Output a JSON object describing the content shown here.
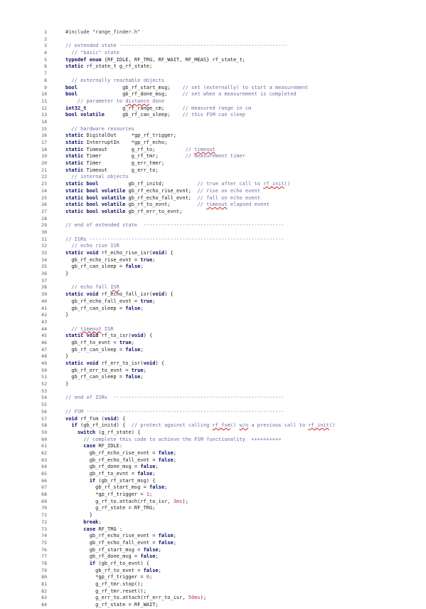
{
  "document": {
    "language": "c++",
    "lines": [
      [
        [
          "pp",
          "#include \"range_finder.h\""
        ]
      ],
      [],
      [
        [
          "cm",
          "// extended state --------------------------------------------------------"
        ]
      ],
      [
        [
          "cm",
          "  // \"basic\" state"
        ]
      ],
      [
        [
          "kw",
          "typedef enum"
        ],
        [
          "t",
          " {RF_IDLE, RF_TRG, RF_WAIT, RF_MEAS} rf_state_t;"
        ]
      ],
      [
        [
          "kw",
          "static"
        ],
        [
          "t",
          " rf_state_t g_rf_state;"
        ]
      ],
      [],
      [
        [
          "cm",
          "  // externally reachable objects"
        ]
      ],
      [
        [
          "kw",
          "bool"
        ],
        [
          "t",
          "               gb_rf_start_msg;    "
        ],
        [
          "cm",
          "// set (externally) to start a measurement"
        ]
      ],
      [
        [
          "kw",
          "bool"
        ],
        [
          "t",
          "               gb_rf_done_msg;     "
        ],
        [
          "cm",
          "// set when a measurement is completed"
        ]
      ],
      [
        [
          "cm",
          "    // parameter to "
        ],
        [
          "sp",
          "distance"
        ],
        [
          "cm",
          " done"
        ]
      ],
      [
        [
          "kw",
          "int32_t"
        ],
        [
          "t",
          "            g_rf_range_cm;      "
        ],
        [
          "cm",
          "// measured range in cm"
        ]
      ],
      [
        [
          "kw",
          "bool volatile"
        ],
        [
          "t",
          "      gb_rf_can_sleep;    "
        ],
        [
          "cm",
          "// this FSM can sleep"
        ]
      ],
      [],
      [
        [
          "cm",
          "  // hardware resources"
        ]
      ],
      [
        [
          "kw",
          "static"
        ],
        [
          "t",
          " DigitalOut     *gp_rf_trigger;"
        ]
      ],
      [
        [
          "kw",
          "static"
        ],
        [
          "t",
          " InterruptIn    *gp_rf_echo;"
        ]
      ],
      [
        [
          "kw",
          "static"
        ],
        [
          "t",
          " Timeout        g_rf_to;          "
        ],
        [
          "cm",
          "// "
        ],
        [
          "sp",
          "timeout"
        ]
      ],
      [
        [
          "kw",
          "static"
        ],
        [
          "t",
          " Timer          g_rf_tmr;         "
        ],
        [
          "cm",
          "// measurement timer"
        ]
      ],
      [
        [
          "kw",
          "static"
        ],
        [
          "t",
          " Timer          g_err_tmer;"
        ]
      ],
      [
        [
          "kw",
          "static"
        ],
        [
          "t",
          " Timeout        g_err_to;"
        ]
      ],
      [
        [
          "cm",
          "  // internal objects"
        ]
      ],
      [
        [
          "kw",
          "static bool"
        ],
        [
          "t",
          "          gb_rf_initd;           "
        ],
        [
          "cm",
          "// true after call to "
        ],
        [
          "sp",
          "rf_init"
        ],
        [
          "cm",
          "()"
        ]
      ],
      [
        [
          "kw",
          "static bool volatile"
        ],
        [
          "t",
          " gb_rf_echo_rise_evnt;  "
        ],
        [
          "cm",
          "// rise on echo event"
        ]
      ],
      [
        [
          "kw",
          "static bool volatile"
        ],
        [
          "t",
          " gb_rf_echo_fall_evnt;  "
        ],
        [
          "cm",
          "// fall on echo event"
        ]
      ],
      [
        [
          "kw",
          "static bool volatile"
        ],
        [
          "t",
          " gb_rf_to_evnt;         "
        ],
        [
          "cm",
          "// "
        ],
        [
          "sp",
          "timeout"
        ],
        [
          "cm",
          " elapsed event"
        ]
      ],
      [
        [
          "kw",
          "static bool volatile"
        ],
        [
          "t",
          " gb_rf_err_to_evnt;"
        ]
      ],
      [],
      [
        [
          "cm",
          "// end of extended state  -----------------------------------------------"
        ]
      ],
      [],
      [
        [
          "cm",
          "// ISRs -----------------------------------------------------------------"
        ]
      ],
      [
        [
          "cm",
          "  // echo rise ISR"
        ]
      ],
      [
        [
          "kw",
          "static void"
        ],
        [
          "t",
          " rf_echo_rise_isr("
        ],
        [
          "kw",
          "void"
        ],
        [
          "t",
          ") {"
        ]
      ],
      [
        [
          "t",
          "  gb_rf_echo_rise_evnt = "
        ],
        [
          "kw",
          "true"
        ],
        [
          "t",
          ";"
        ]
      ],
      [
        [
          "t",
          "  gb_rf_can_sleep = "
        ],
        [
          "kw",
          "false"
        ],
        [
          "t",
          ";"
        ]
      ],
      [
        [
          "t",
          "}"
        ]
      ],
      [],
      [
        [
          "cm",
          "  // echo fall "
        ],
        [
          "sp",
          "ISR"
        ]
      ],
      [
        [
          "kw",
          "static void"
        ],
        [
          "t",
          " rf_echo_fall_isr("
        ],
        [
          "kw",
          "void"
        ],
        [
          "t",
          ") {"
        ]
      ],
      [
        [
          "t",
          "  gb_rf_echo_fall_evnt = "
        ],
        [
          "kw",
          "true"
        ],
        [
          "t",
          ";"
        ]
      ],
      [
        [
          "t",
          "  gb_rf_can_sleep = "
        ],
        [
          "kw",
          "false"
        ],
        [
          "t",
          ";"
        ]
      ],
      [
        [
          "t",
          "}"
        ]
      ],
      [],
      [
        [
          "cm",
          "  // "
        ],
        [
          "sp",
          "timeout"
        ],
        [
          "cm",
          " ISR"
        ]
      ],
      [
        [
          "kw",
          "static void"
        ],
        [
          "t",
          " rf_to_isr("
        ],
        [
          "kw",
          "void"
        ],
        [
          "t",
          ") {"
        ]
      ],
      [
        [
          "t",
          "  gb_rf_to_evnt = "
        ],
        [
          "kw",
          "true"
        ],
        [
          "t",
          ";"
        ]
      ],
      [
        [
          "t",
          "  gb_rf_can_sleep = "
        ],
        [
          "kw",
          "false"
        ],
        [
          "t",
          ";"
        ]
      ],
      [
        [
          "t",
          "}"
        ]
      ],
      [
        [
          "kw",
          "static void"
        ],
        [
          "t",
          " rf_err_to_isr("
        ],
        [
          "kw",
          "void"
        ],
        [
          "t",
          ") {"
        ]
      ],
      [
        [
          "t",
          "  gb_rf_err_to_evnt = "
        ],
        [
          "kw",
          "true"
        ],
        [
          "t",
          ";"
        ]
      ],
      [
        [
          "t",
          "  gb_rf_can_sleep = "
        ],
        [
          "kw",
          "false"
        ],
        [
          "t",
          ";"
        ]
      ],
      [
        [
          "t",
          "}"
        ]
      ],
      [],
      [
        [
          "cm",
          "// end of ISRs  ---------------------------------------------------------"
        ]
      ],
      [],
      [
        [
          "cm",
          "// FSM ------------------------------------------------------------------"
        ]
      ],
      [
        [
          "kw",
          "void"
        ],
        [
          "t",
          " rf_fsm ("
        ],
        [
          "kw",
          "void"
        ],
        [
          "t",
          ") {"
        ]
      ],
      [
        [
          "t",
          "  "
        ],
        [
          "kw",
          "if"
        ],
        [
          "t",
          " (gb_rf_initd) {  "
        ],
        [
          "cm",
          "// protect against calling "
        ],
        [
          "sp",
          "rf_fsm"
        ],
        [
          "cm",
          "() "
        ],
        [
          "sp",
          "w/o"
        ],
        [
          "cm",
          " a previous call to "
        ],
        [
          "sp",
          "rf_init"
        ],
        [
          "cm",
          "()"
        ]
      ],
      [
        [
          "t",
          "    "
        ],
        [
          "kw",
          "switch"
        ],
        [
          "t",
          " (g_rf_state) {"
        ]
      ],
      [
        [
          "cm",
          "      // complete this code to achieve the FSM functionality  ++++++++++"
        ]
      ],
      [
        [
          "t",
          "      "
        ],
        [
          "kw",
          "case"
        ],
        [
          "t",
          " RF_IDLE:"
        ]
      ],
      [
        [
          "t",
          "        gb_rf_echo_rise_evnt = "
        ],
        [
          "kw",
          "false"
        ],
        [
          "t",
          ";"
        ]
      ],
      [
        [
          "t",
          "        gb_rf_echo_fall_evnt = "
        ],
        [
          "kw",
          "false"
        ],
        [
          "t",
          ";"
        ]
      ],
      [
        [
          "t",
          "        gb_rf_done_msg = "
        ],
        [
          "kw",
          "false"
        ],
        [
          "t",
          ";"
        ]
      ],
      [
        [
          "t",
          "        gb_rf_to_evnt = "
        ],
        [
          "kw",
          "false"
        ],
        [
          "t",
          ";"
        ]
      ],
      [
        [
          "t",
          "        "
        ],
        [
          "kw",
          "if"
        ],
        [
          "t",
          " (gb_rf_start_msg) {"
        ]
      ],
      [
        [
          "t",
          "          gb_rf_start_msg = "
        ],
        [
          "kw",
          "false"
        ],
        [
          "t",
          ";"
        ]
      ],
      [
        [
          "t",
          "          *gp_rf_trigger = "
        ],
        [
          "num",
          "1"
        ],
        [
          "t",
          ";"
        ]
      ],
      [
        [
          "t",
          "          g_rf_to.attach(rf_to_isr, "
        ],
        [
          "num",
          "3ms"
        ],
        [
          "t",
          ");"
        ]
      ],
      [
        [
          "t",
          "          g_rf_state = RF_TRG;"
        ]
      ],
      [
        [
          "t",
          "        }"
        ]
      ],
      [
        [
          "t",
          "      "
        ],
        [
          "kw",
          "break"
        ],
        [
          "t",
          ";"
        ]
      ],
      [
        [
          "t",
          "      "
        ],
        [
          "kw",
          "case"
        ],
        [
          "t",
          " RF_TRG :"
        ]
      ],
      [
        [
          "t",
          "        gb_rf_echo_rise_evnt = "
        ],
        [
          "kw",
          "false"
        ],
        [
          "t",
          ";"
        ]
      ],
      [
        [
          "t",
          "        gb_rf_echo_fall_evnt = "
        ],
        [
          "kw",
          "false"
        ],
        [
          "t",
          ";"
        ]
      ],
      [
        [
          "t",
          "        gb_rf_start_msg = "
        ],
        [
          "kw",
          "false"
        ],
        [
          "t",
          ";"
        ]
      ],
      [
        [
          "t",
          "        gb_rf_done_msg = "
        ],
        [
          "kw",
          "false"
        ],
        [
          "t",
          ";"
        ]
      ],
      [
        [
          "t",
          "        "
        ],
        [
          "kw",
          "if"
        ],
        [
          "t",
          " (gb_rf_to_evnt) {"
        ]
      ],
      [
        [
          "t",
          "          gb_rf_to_evnt = "
        ],
        [
          "kw",
          "false"
        ],
        [
          "t",
          ";"
        ]
      ],
      [
        [
          "t",
          "          *gp_rf_trigger = "
        ],
        [
          "num",
          "0"
        ],
        [
          "t",
          ";"
        ]
      ],
      [
        [
          "t",
          "          g_rf_tmr.stop();"
        ]
      ],
      [
        [
          "t",
          "          g_rf_tmr.reset();"
        ]
      ],
      [
        [
          "t",
          "          g_err_to.attach(rf_err_to_isr, "
        ],
        [
          "num",
          "50ms"
        ],
        [
          "t",
          ");"
        ]
      ],
      [
        [
          "t",
          "          g_rf_state = RF_WAIT;"
        ]
      ]
    ]
  }
}
